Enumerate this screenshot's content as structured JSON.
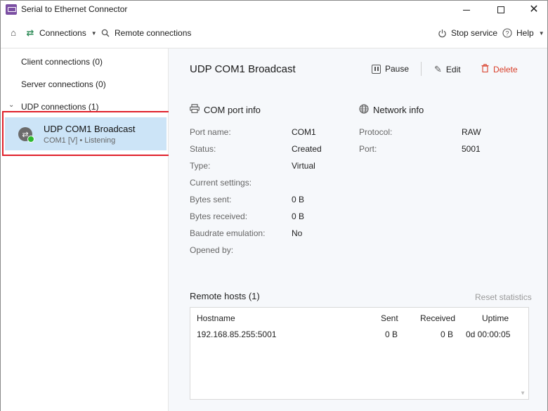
{
  "window": {
    "title": "Serial to Ethernet Connector",
    "minimize": "–",
    "maximize": "□",
    "close": "✕",
    "accent": "#7b4fa3"
  },
  "toolbar": {
    "home_icon": "⌂",
    "connections_label": "Connections",
    "connections_icon": "⇄",
    "remote_label": "Remote connections",
    "remote_icon": "🔍",
    "stop_label": "Stop service",
    "stop_icon": "⏻",
    "help_label": "Help",
    "help_icon": "?"
  },
  "sidebar": {
    "client_connections": "Client connections (0)",
    "server_connections": "Server connections (0)",
    "udp_connections": "UDP connections (1)",
    "selected": {
      "name": "UDP COM1 Broadcast",
      "subtitle": "COM1 [V] • Listening",
      "status_color": "#2eb82e"
    }
  },
  "main": {
    "title": "UDP COM1 Broadcast",
    "actions": {
      "pause": "Pause",
      "edit": "Edit",
      "delete": "Delete",
      "delete_color": "#d9402b"
    },
    "com_port_info": {
      "title": "COM port info",
      "rows": [
        {
          "label": "Port name:",
          "value": "COM1"
        },
        {
          "label": "Status:",
          "value": "Created"
        },
        {
          "label": "Type:",
          "value": "Virtual"
        },
        {
          "label": "Current settings:",
          "value": ""
        },
        {
          "label": "Bytes sent:",
          "value": "0 B"
        },
        {
          "label": "Bytes received:",
          "value": "0 B"
        },
        {
          "label": "Baudrate emulation:",
          "value": "No"
        },
        {
          "label": "Opened by:",
          "value": ""
        }
      ]
    },
    "network_info": {
      "title": "Network info",
      "rows": [
        {
          "label": "Protocol:",
          "value": "RAW"
        },
        {
          "label": "Port:",
          "value": "5001"
        }
      ]
    },
    "remote_hosts": {
      "title": "Remote hosts (1)",
      "reset_label": "Reset statistics",
      "columns": [
        "Hostname",
        "Sent",
        "Received",
        "Uptime"
      ],
      "rows": [
        {
          "hostname": "192.168.85.255:5001",
          "sent": "0 B",
          "received": "0 B",
          "uptime": "0d 00:00:05"
        }
      ]
    }
  }
}
